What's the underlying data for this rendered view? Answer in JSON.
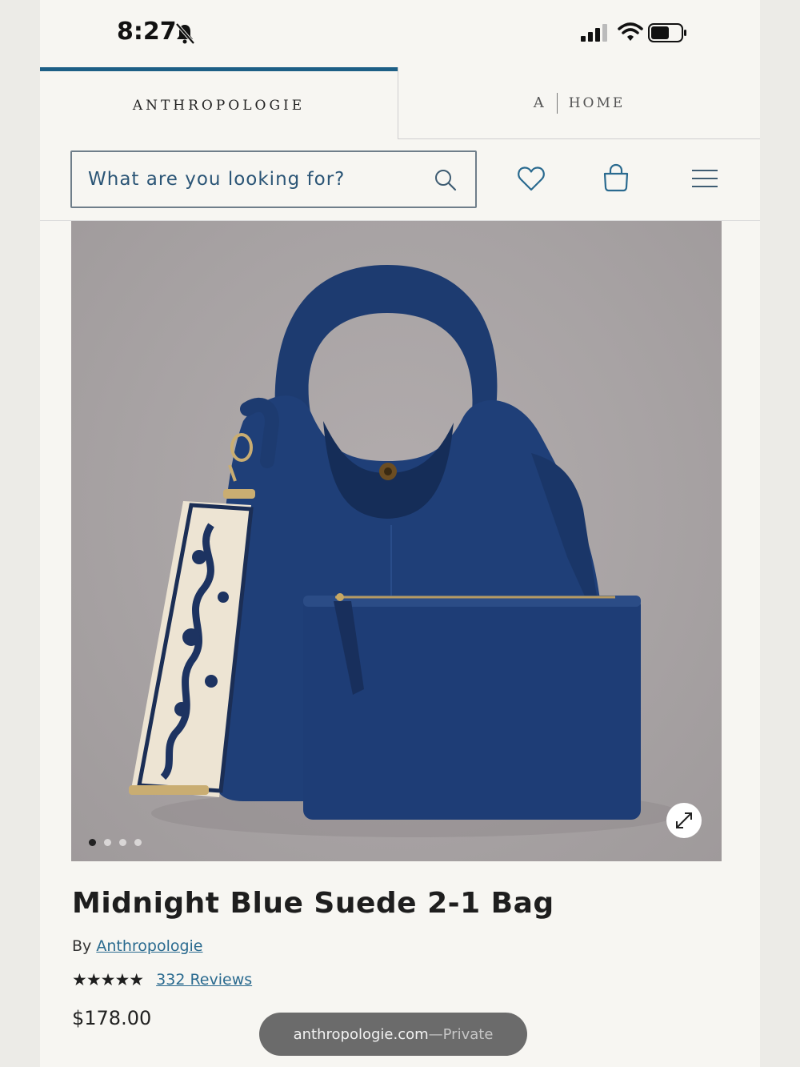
{
  "status_bar": {
    "time": "8:27"
  },
  "brand_tabs": {
    "anthropologie": "ANTHROPOLOGIE",
    "home_mark": "A",
    "home_label": "HOME"
  },
  "search": {
    "placeholder": "What are you looking for?"
  },
  "icons": {
    "search": "search-icon",
    "wishlist": "heart-icon",
    "cart": "shopping-bag-icon",
    "menu": "hamburger-menu-icon",
    "expand": "expand-icon"
  },
  "product": {
    "title": "Midnight Blue Suede 2-1 Bag",
    "by_label": "By",
    "brand": "Anthropologie",
    "rating_stars": "★★★★★",
    "rating": 5,
    "reviews_label": "332 Reviews",
    "price": "$178.00",
    "image_count": 4,
    "active_image": 1
  },
  "browser": {
    "domain": "anthropologie.com",
    "separator": " — ",
    "mode": "Private"
  },
  "colors": {
    "accent": "#1d5f86",
    "link": "#2a6a8f",
    "bag": "#1f3f78"
  }
}
